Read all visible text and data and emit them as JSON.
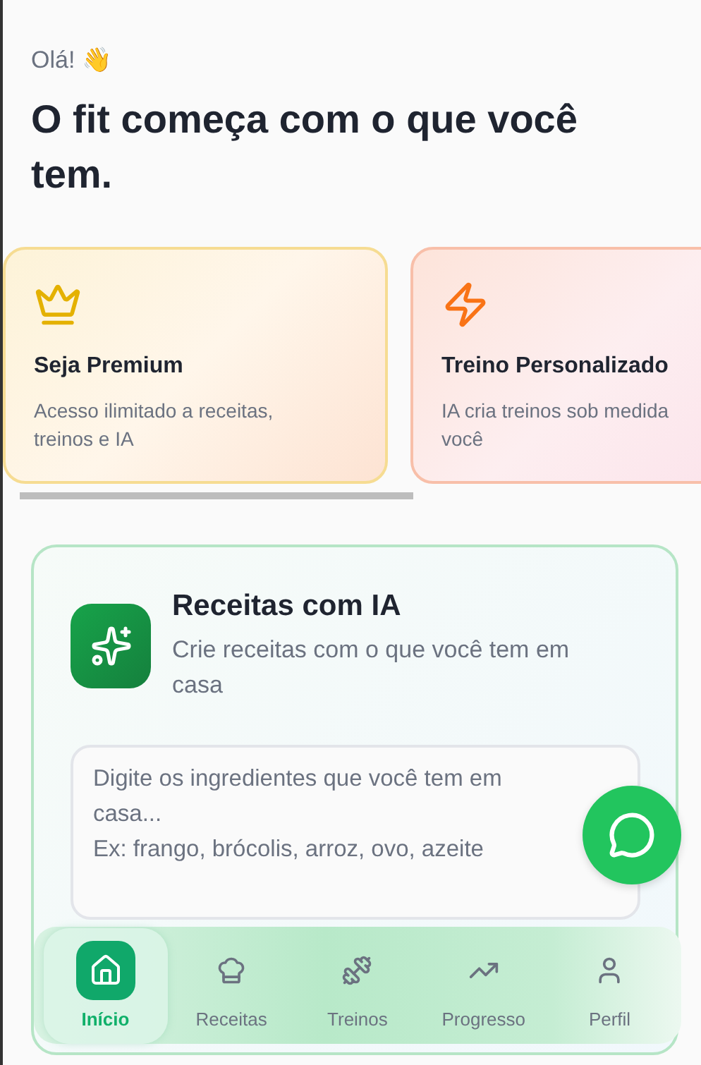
{
  "greeting": "Olá! 👋",
  "headline": "O fit começa com o que você tem.",
  "promo_cards": [
    {
      "kind": "premium",
      "title": "Seja Premium",
      "description_lines": [
        "Acesso ilimitado a receitas,",
        "treinos e IA"
      ]
    },
    {
      "kind": "workout",
      "title": "Treino Personalizado",
      "description_lines": [
        "IA cria treinos sob medida",
        "você"
      ]
    }
  ],
  "recipe_card": {
    "title": "Receitas com IA",
    "subtitle": "Crie receitas com o que você tem em casa",
    "ingredients_field": {
      "placeholder": "Digite os ingredientes que você tem em casa...\nEx: frango, brócolis, arroz, ovo, azeite"
    }
  },
  "bottom_nav": [
    {
      "kind": "home",
      "label": "Início",
      "selected": true
    },
    {
      "kind": "recipes",
      "label": "Receitas",
      "selected": false
    },
    {
      "kind": "workouts",
      "label": "Treinos",
      "selected": false
    },
    {
      "kind": "progress",
      "label": "Progresso",
      "selected": false
    },
    {
      "kind": "profile",
      "label": "Perfil",
      "selected": false
    }
  ]
}
